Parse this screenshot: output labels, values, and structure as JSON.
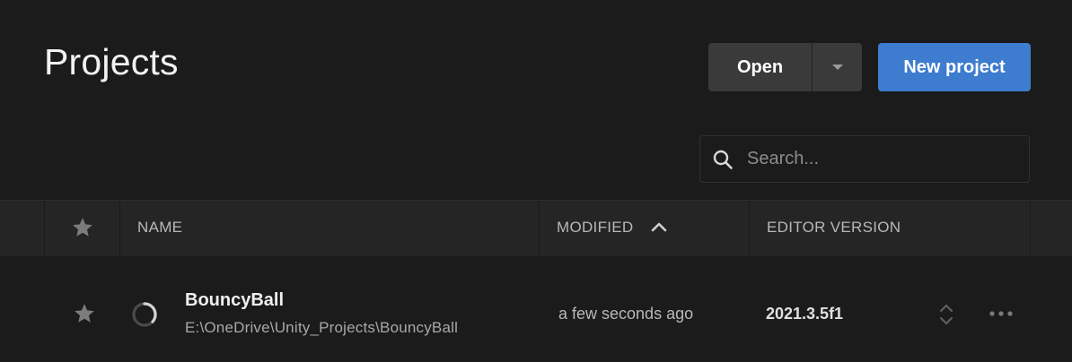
{
  "header": {
    "title": "Projects",
    "open_label": "Open",
    "new_project_label": "New project"
  },
  "search": {
    "placeholder": "Search...",
    "value": ""
  },
  "table": {
    "columns": {
      "favorite_icon": "star-icon",
      "name": "NAME",
      "modified": "MODIFIED",
      "editor_version": "EDITOR VERSION"
    },
    "sort": {
      "column": "MODIFIED",
      "direction": "ascending",
      "icon": "chevron-up-icon"
    },
    "rows": [
      {
        "name": "BouncyBall",
        "path": "E:\\OneDrive\\Unity_Projects\\BouncyBall",
        "modified": "a few seconds ago",
        "editor_version": "2021.3.5f1",
        "favorite": false,
        "status_icon": "loading-spinner-icon"
      }
    ]
  },
  "colors": {
    "background": "#1b1b1b",
    "header_row": "#252525",
    "button_secondary": "#3a3a3a",
    "button_primary": "#3d7ccf",
    "text_primary": "#f0f0f0",
    "text_secondary": "#b8b8b8"
  }
}
